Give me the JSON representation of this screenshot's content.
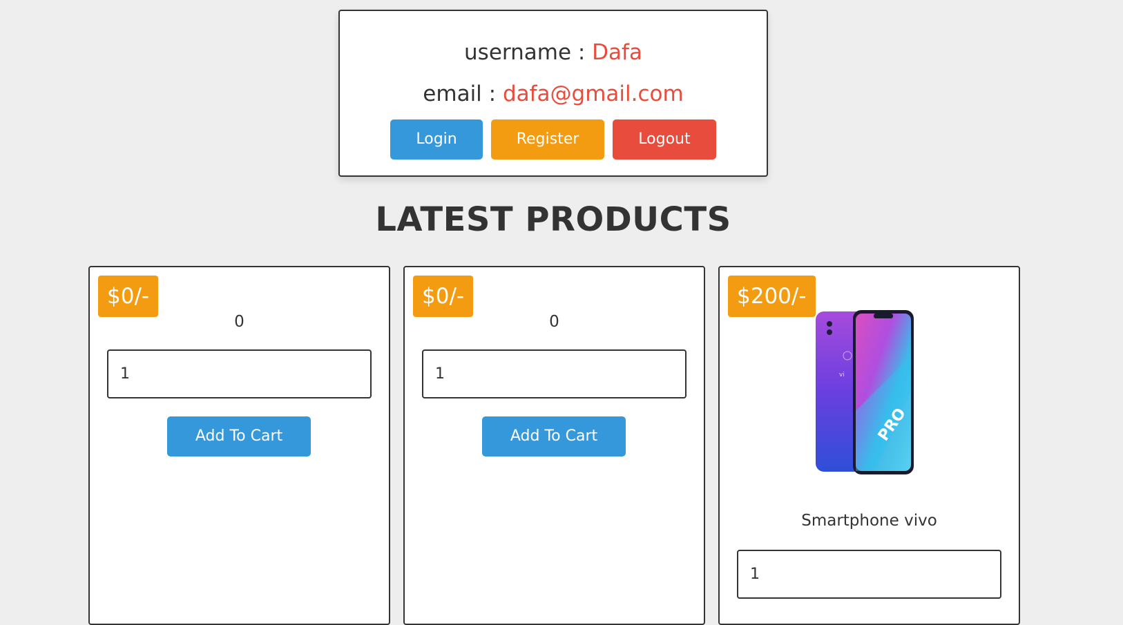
{
  "user": {
    "username_label": "username : ",
    "username_value": "Dafa",
    "email_label": "email : ",
    "email_value": "dafa@gmail.com",
    "buttons": {
      "login": "Login",
      "register": "Register",
      "logout": "Logout"
    }
  },
  "heading": "LATEST PRODUCTS",
  "products": [
    {
      "price": "$0/-",
      "name": "0",
      "qty": "1",
      "cart_label": "Add To Cart"
    },
    {
      "price": "$0/-",
      "name": "0",
      "qty": "1",
      "cart_label": "Add To Cart"
    },
    {
      "price": "$200/-",
      "name": "Smartphone vivo",
      "qty": "1",
      "image": "smartphone-vivo-image"
    }
  ],
  "colors": {
    "background": "#eeeeee",
    "accent_red": "#e74c3c",
    "button_blue": "#3498db",
    "button_orange": "#f39c12",
    "border": "#333333"
  }
}
